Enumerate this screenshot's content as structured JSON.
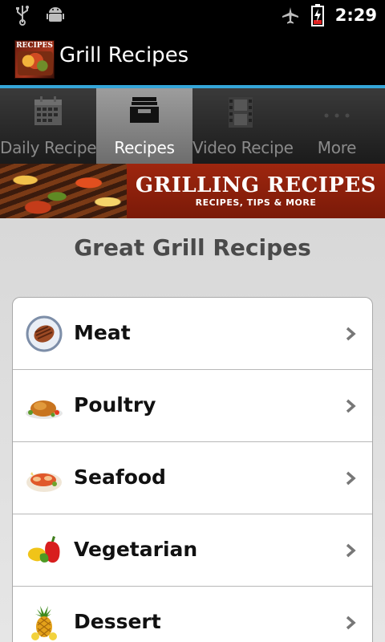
{
  "status_bar": {
    "time": "2:29"
  },
  "app": {
    "title": "Grill Recipes",
    "icon_label": "RECIPES"
  },
  "tabs": [
    {
      "label": "Daily Recipes",
      "icon": "calendar-icon",
      "selected": false
    },
    {
      "label": "Recipes",
      "icon": "inbox-tray-icon",
      "selected": true
    },
    {
      "label": "Video Recipe",
      "icon": "film-strip-icon",
      "selected": false
    },
    {
      "label": "More",
      "icon": "more-dots-icon",
      "selected": false
    }
  ],
  "banner": {
    "title": "GRILLING RECIPES",
    "subtitle": "RECIPES, TIPS & MORE"
  },
  "page": {
    "heading": "Great Grill Recipes"
  },
  "categories": [
    {
      "label": "Meat",
      "icon": "steak-icon"
    },
    {
      "label": "Poultry",
      "icon": "roast-chicken-icon"
    },
    {
      "label": "Seafood",
      "icon": "seafood-icon"
    },
    {
      "label": "Vegetarian",
      "icon": "peppers-icon"
    },
    {
      "label": "Dessert",
      "icon": "pineapple-icon"
    }
  ],
  "colors": {
    "accent_line": "#35a6d8",
    "banner_red": "#9e260f",
    "selected_tab": "#8a8a8a"
  }
}
